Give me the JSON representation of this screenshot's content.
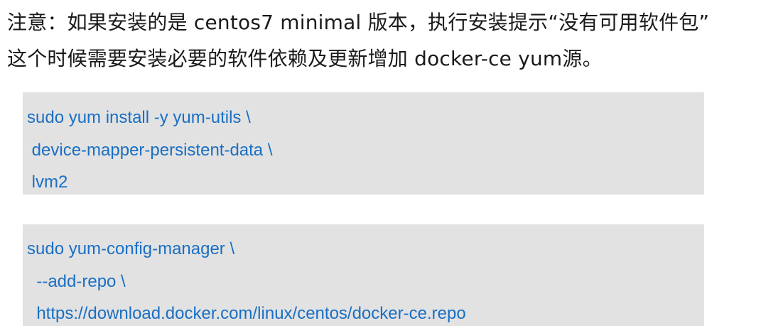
{
  "note": {
    "line1": "注意：如果安装的是 centos7 minimal 版本，执行安装提示“没有可用软件包”",
    "line2": "这个时候需要安装必要的软件依赖及更新增加 docker-ce yum源。"
  },
  "code_blocks": [
    {
      "lines": [
        "sudo yum install -y yum-utils \\",
        " device-mapper-persistent-data \\",
        " lvm2"
      ]
    },
    {
      "lines": [
        "sudo yum-config-manager \\",
        "  --add-repo \\",
        "  https://download.docker.com/linux/centos/docker-ce.repo"
      ]
    }
  ],
  "colors": {
    "code_text": "#1a6fc4",
    "code_background": "#e2e2e2",
    "body_text": "#1a1a1a"
  }
}
